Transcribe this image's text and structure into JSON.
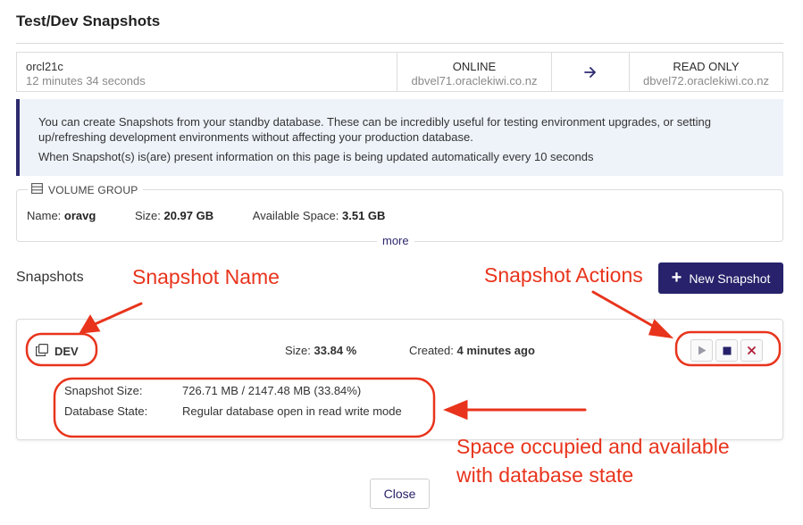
{
  "page": {
    "title": "Test/Dev Snapshots"
  },
  "database": {
    "name": "orcl21c",
    "age": "12 minutes 34 seconds",
    "primary_status": "ONLINE",
    "primary_host": "dbvel71.oraclekiwi.co.nz",
    "standby_status": "READ ONLY",
    "standby_host": "dbvel72.oraclekiwi.co.nz",
    "arrow_icon": "arrow-right-icon"
  },
  "info": {
    "line1": "You can create Snapshots from your standby database. These can be incredibly useful for testing environment upgrades, or setting up/refreshing development environments without affecting your production database.",
    "line2": "When Snapshot(s) is(are) present information on this page is being updated automatically every 10 seconds",
    "accent_color": "#2d2a6e"
  },
  "volume_group": {
    "heading": "VOLUME GROUP",
    "icon": "server-icon",
    "name_label": "Name:",
    "name_value": "oravg",
    "size_label": "Size:",
    "size_value": "20.97 GB",
    "available_label": "Available Space:",
    "available_value": "3.51 GB",
    "more_label": "more"
  },
  "snapshots": {
    "heading": "Snapshots",
    "new_button_label": "New Snapshot",
    "button_color": "#27226b",
    "items": [
      {
        "name": "DEV",
        "icon": "copy-icon",
        "size_label": "Size:",
        "size_value": "33.84 %",
        "created_label": "Created:",
        "created_value": "4 minutes ago",
        "actions": [
          "play-icon",
          "stop-icon",
          "close-icon"
        ],
        "details": [
          {
            "key": "Snapshot Size:",
            "value": "726.71 MB / 2147.48 MB (33.84%)"
          },
          {
            "key": "Database State:",
            "value": "Regular database open in read write mode"
          }
        ]
      }
    ]
  },
  "footer": {
    "close_label": "Close"
  },
  "annotations": {
    "snapshot_name": "Snapshot Name",
    "snapshot_actions": "Snapshot Actions",
    "space_line1": "Space occupied and available",
    "space_line2": "with database state",
    "color": "#e8341c"
  }
}
